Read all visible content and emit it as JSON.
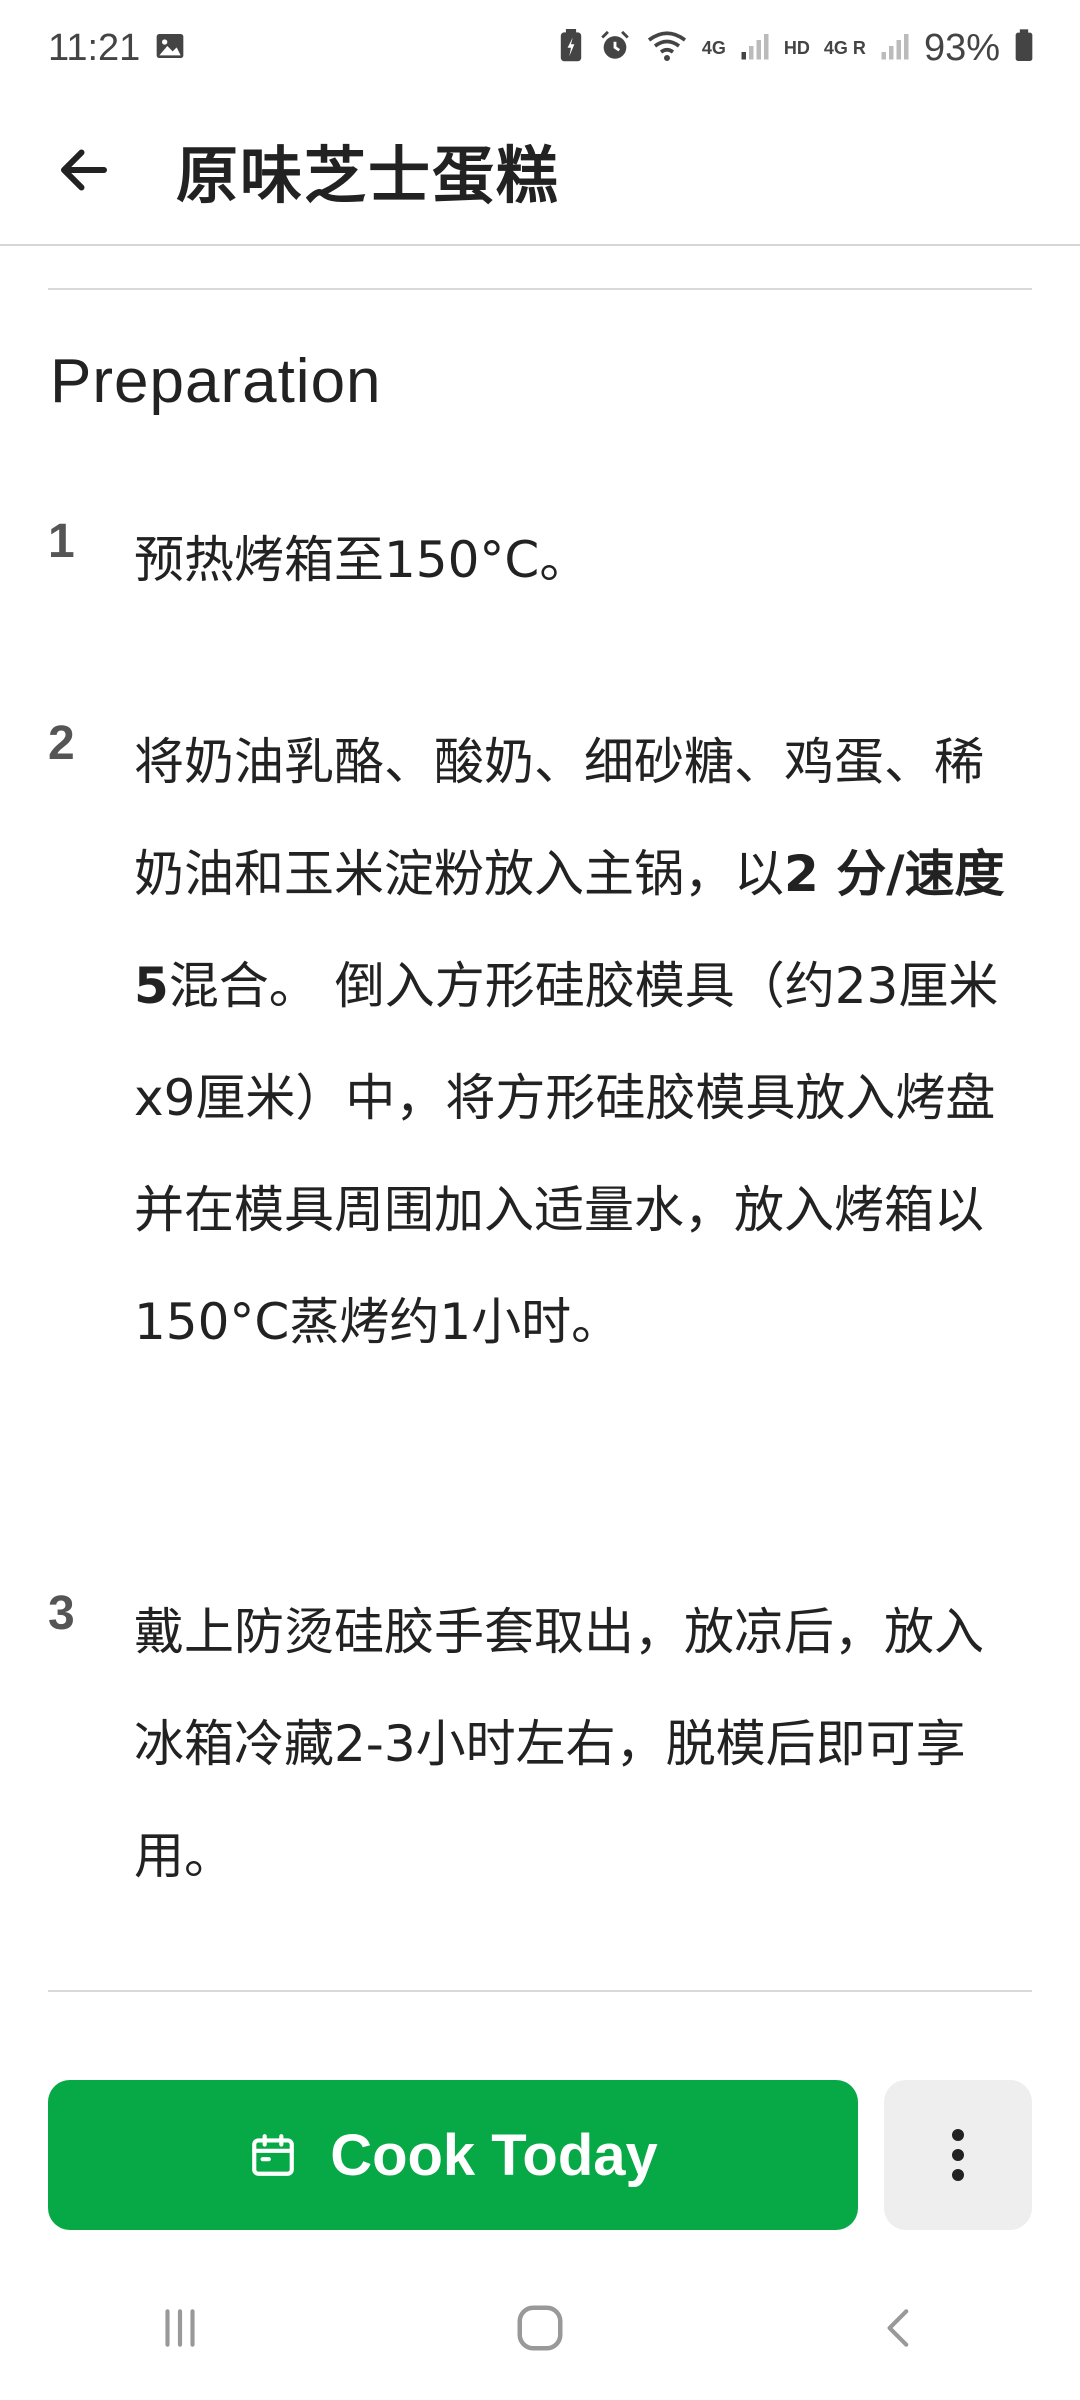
{
  "status_bar": {
    "time": "11:21",
    "network_4g": "4G",
    "hd": "HD",
    "network_4g_r": "4G R",
    "battery": "93%"
  },
  "app_bar": {
    "title": "原味芝士蛋糕"
  },
  "preparation": {
    "heading": "Preparation",
    "steps": [
      {
        "number": "1",
        "text": "预热烤箱至150°C。"
      },
      {
        "number": "2",
        "text_before": "将奶油乳酪、酸奶、细砂糖、鸡蛋、稀奶油和玉米淀粉放入主锅，以",
        "bold": "2 分/速度 5",
        "text_after": "混合。 倒入方形硅胶模具（约23厘米x9厘米）中，将方形硅胶模具放入烤盘并在模具周围加入适量水，放入烤箱以150°C蒸烤约1小时。"
      },
      {
        "number": "3",
        "text": "戴上防烫硅胶手套取出，放凉后，放入冰箱冷藏2-3小时左右，脱模后即可享用。"
      }
    ]
  },
  "actions": {
    "cook_today_label": "Cook Today",
    "more_icon": "more-vertical-icon",
    "calendar_icon": "calendar-icon"
  },
  "colors": {
    "primary_green": "#07a846",
    "secondary_gray": "#eeeeee"
  }
}
